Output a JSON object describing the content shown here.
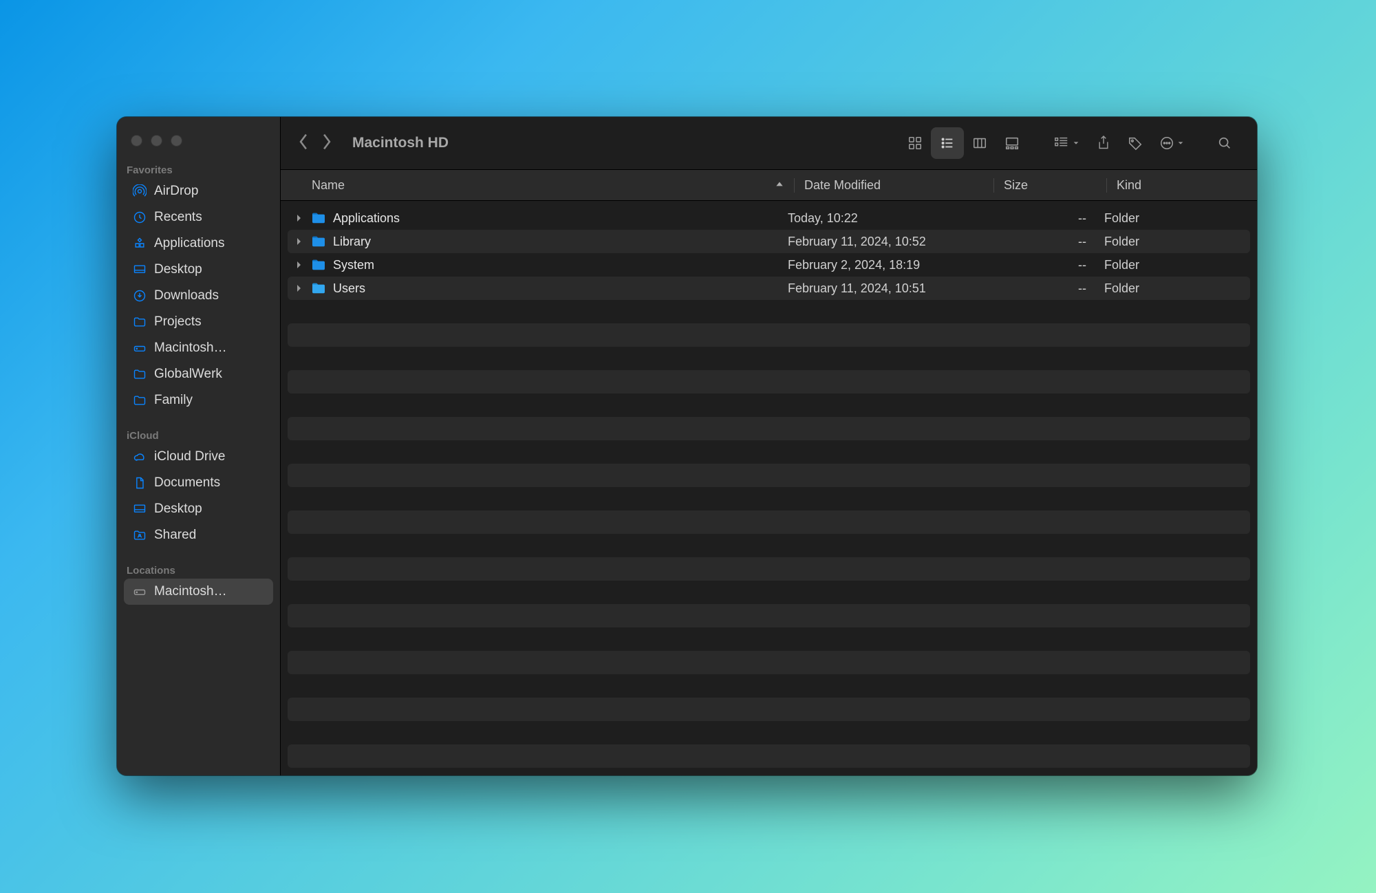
{
  "window": {
    "title": "Macintosh HD"
  },
  "sidebar": {
    "sections": {
      "favorites": {
        "title": "Favorites",
        "items": [
          {
            "icon": "airdrop-icon",
            "label": "AirDrop"
          },
          {
            "icon": "clock-icon",
            "label": "Recents"
          },
          {
            "icon": "app-icon",
            "label": "Applications"
          },
          {
            "icon": "desktop-icon",
            "label": "Desktop"
          },
          {
            "icon": "download-icon",
            "label": "Downloads"
          },
          {
            "icon": "folder-icon",
            "label": "Projects"
          },
          {
            "icon": "disk-icon",
            "label": "Macintosh…"
          },
          {
            "icon": "folder-icon",
            "label": "GlobalWerk"
          },
          {
            "icon": "folder-icon",
            "label": "Family"
          }
        ]
      },
      "icloud": {
        "title": "iCloud",
        "items": [
          {
            "icon": "cloud-icon",
            "label": "iCloud Drive"
          },
          {
            "icon": "document-icon",
            "label": "Documents"
          },
          {
            "icon": "desktop-icon",
            "label": "Desktop"
          },
          {
            "icon": "shared-icon",
            "label": "Shared"
          }
        ]
      },
      "locations": {
        "title": "Locations",
        "items": [
          {
            "icon": "disk-icon",
            "label": "Macintosh…"
          }
        ],
        "selected_index": 0
      }
    }
  },
  "columns": {
    "name": "Name",
    "date": "Date Modified",
    "size": "Size",
    "kind": "Kind",
    "sort_column": "name",
    "sort_direction": "asc"
  },
  "files": {
    "rows": [
      {
        "name": "Applications",
        "date": "Today, 10:22",
        "size": "--",
        "kind": "Folder"
      },
      {
        "name": "Library",
        "date": "February 11, 2024, 10:52",
        "size": "--",
        "kind": "Folder"
      },
      {
        "name": "System",
        "date": "February 2, 2024, 18:19",
        "size": "--",
        "kind": "Folder"
      },
      {
        "name": "Users",
        "date": "February 11, 2024, 10:51",
        "size": "--",
        "kind": "Folder"
      }
    ]
  }
}
